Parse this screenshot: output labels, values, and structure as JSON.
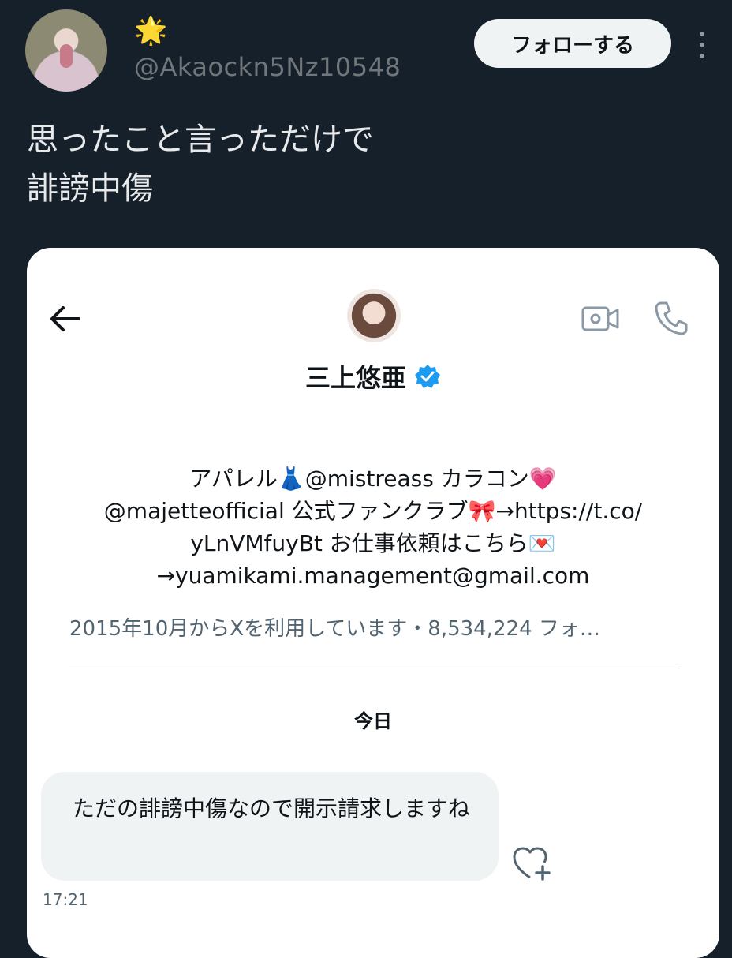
{
  "tweet": {
    "author_emoji": "🌟",
    "handle": "@Akaockn5Nz10548",
    "follow_label": "フォローする",
    "text_lines": [
      "思ったこと言っただけで",
      "誹謗中傷"
    ]
  },
  "dm": {
    "name": "三上悠亜",
    "bio": {
      "line1_a": "アパレル",
      "line1_dress": "👗",
      "line1_b": "@mistreass カラコン",
      "line1_heart": "💗",
      "line2_a": "@majetteofficial 公式ファンクラブ",
      "line2_ribbon": "🎀",
      "line2_b": "→https://t.co/",
      "line3_a": "yLnVMfuyBt お仕事依頼はこちら",
      "line3_envelope": "💌",
      "line4": "→yuamikami.management@gmail.com"
    },
    "joined": "2015年10月からXを利用しています・8,534,224 フォ…",
    "date_divider": "今日",
    "message": {
      "text": "ただの誹謗中傷なので開示請求しますね",
      "time": "17:21"
    }
  },
  "colors": {
    "background": "#15202b",
    "verified": "#1d9bf0",
    "card": "#ffffff",
    "bubble": "#eff3f4"
  },
  "icons": [
    "more-vertical-icon",
    "back-arrow-icon",
    "video-call-icon",
    "phone-icon",
    "verified-badge-icon",
    "add-reaction-icon"
  ]
}
